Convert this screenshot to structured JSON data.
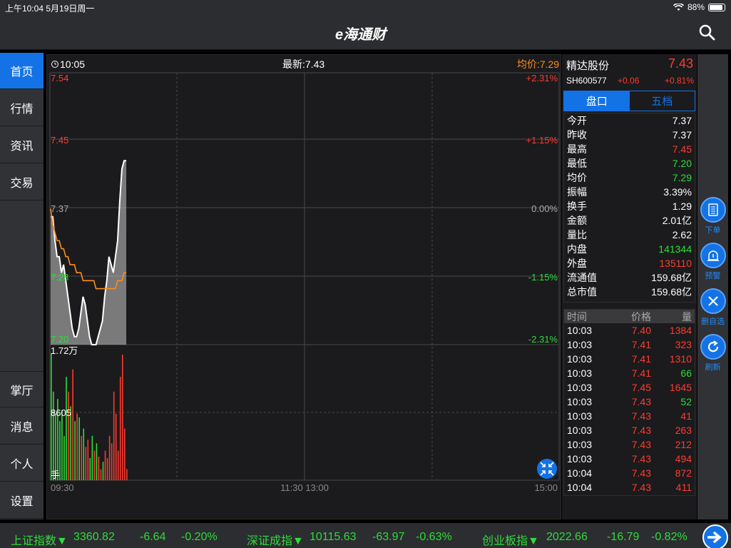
{
  "status_bar": {
    "time": "上午10:04",
    "date": "5月19日周一",
    "battery": "88%"
  },
  "header": {
    "logo": "e海通财"
  },
  "sidebar": {
    "top_items": [
      {
        "label": "首页"
      },
      {
        "label": "行情"
      },
      {
        "label": "资讯"
      },
      {
        "label": "交易"
      }
    ],
    "bottom_items": [
      {
        "label": "掌厅"
      },
      {
        "label": "消息"
      },
      {
        "label": "个人"
      },
      {
        "label": "设置"
      }
    ]
  },
  "chart_header": {
    "time": "10:05",
    "latest": "最新:7.43",
    "avg": "均价:7.29"
  },
  "chart_labels": {
    "price_ticks": [
      "7.54",
      "7.45",
      "7.37",
      "7.28",
      "7.20"
    ],
    "pct_ticks": [
      "+2.31%",
      "+1.15%",
      "0.00%",
      "-1.15%",
      "-2.31%"
    ],
    "vol_max": "1.72万",
    "vol_mid": "8605",
    "vol_unit": "手",
    "x_ticks": [
      "09:30",
      "11:30 13:00",
      "15:00"
    ]
  },
  "chart_data": [
    {
      "type": "line",
      "x": [
        "09:30",
        "09:31",
        "09:32",
        "09:33",
        "09:34",
        "09:35",
        "09:36",
        "09:37",
        "09:38",
        "09:39",
        "09:40",
        "09:41",
        "09:42",
        "09:43",
        "09:44",
        "09:45",
        "09:46",
        "09:47",
        "09:48",
        "09:49",
        "09:50",
        "09:51",
        "09:52",
        "09:53",
        "09:54",
        "09:55",
        "09:56",
        "09:57",
        "09:58",
        "09:59",
        "10:00",
        "10:01",
        "10:02",
        "10:03",
        "10:04",
        "10:05"
      ],
      "series": [
        {
          "values": [
            7.36,
            7.36,
            7.33,
            7.31,
            7.31,
            7.29,
            7.3,
            7.28,
            7.26,
            7.24,
            7.22,
            7.21,
            7.21,
            7.22,
            7.24,
            7.26,
            7.25,
            7.23,
            7.21,
            7.2,
            7.2,
            7.2,
            7.21,
            7.22,
            7.23,
            7.26,
            7.28,
            7.31,
            7.3,
            7.29,
            7.31,
            7.33,
            7.38,
            7.42,
            7.43,
            7.43
          ]
        },
        {
          "values": [
            7.37,
            7.35,
            7.34,
            7.33,
            7.33,
            7.32,
            7.32,
            7.31,
            7.31,
            7.3,
            7.3,
            7.3,
            7.29,
            7.29,
            7.29,
            7.28,
            7.28,
            7.28,
            7.28,
            7.28,
            7.28,
            7.27,
            7.27,
            7.27,
            7.27,
            7.27,
            7.27,
            7.27,
            7.27,
            7.27,
            7.27,
            7.28,
            7.28,
            7.28,
            7.29,
            7.29
          ]
        }
      ],
      "ylim": [
        7.2,
        7.54
      ]
    },
    {
      "type": "bar",
      "values": [
        17200,
        12000,
        9000,
        11000,
        8000,
        9500,
        6000,
        14000,
        12000,
        10000,
        15000,
        8000,
        9000,
        8500,
        6000,
        7000,
        4500,
        5500,
        3000,
        6000,
        4000,
        5000,
        3200,
        1500,
        2500,
        4000,
        3000,
        6000,
        5000,
        12000,
        9000,
        4000,
        14000,
        17000,
        7000,
        1500
      ],
      "colors": [
        "dn",
        "dn",
        "dn",
        "dn",
        "dn",
        "dn",
        "dn",
        "dn",
        "up",
        "dn",
        "up",
        "dn",
        "up",
        "dn",
        "up",
        "dn",
        "up",
        "up",
        "dn",
        "dn",
        "up",
        "dn",
        "up",
        "up",
        "dn",
        "up",
        "up",
        "up",
        "up",
        "up",
        "up",
        "up",
        "up",
        "up",
        "up",
        "up"
      ],
      "ylim": [
        0,
        17200
      ]
    }
  ],
  "stock": {
    "name": "精达股份",
    "price": "7.43",
    "code": "SH600577",
    "change": "+0.06",
    "pct": "+0.81%"
  },
  "tabs": [
    {
      "label": "盘口"
    },
    {
      "label": "五档"
    }
  ],
  "quotes": [
    {
      "label": "今开",
      "value": "7.37",
      "color": "eq"
    },
    {
      "label": "昨收",
      "value": "7.37",
      "color": "eq"
    },
    {
      "label": "最高",
      "value": "7.45",
      "color": "up"
    },
    {
      "label": "最低",
      "value": "7.20",
      "color": "dn"
    },
    {
      "label": "均价",
      "value": "7.29",
      "color": "dn"
    },
    {
      "label": "振幅",
      "value": "3.39%",
      "color": "eq"
    },
    {
      "label": "换手",
      "value": "1.29",
      "color": "eq"
    },
    {
      "label": "金额",
      "value": "2.01亿",
      "color": "eq"
    },
    {
      "label": "量比",
      "value": "2.62",
      "color": "eq"
    },
    {
      "label": "内盘",
      "value": "141344",
      "color": "dn"
    },
    {
      "label": "外盘",
      "value": "135110",
      "color": "up"
    },
    {
      "label": "流通值",
      "value": "159.68亿",
      "color": "eq"
    },
    {
      "label": "总市值",
      "value": "159.68亿",
      "color": "eq"
    }
  ],
  "trades_header": {
    "time": "时间",
    "price": "价格",
    "vol": "量"
  },
  "trades": [
    {
      "time": "10:03",
      "price": "7.40",
      "vol": "1384",
      "vcolor": "up"
    },
    {
      "time": "10:03",
      "price": "7.41",
      "vol": "323",
      "vcolor": "up"
    },
    {
      "time": "10:03",
      "price": "7.41",
      "vol": "1310",
      "vcolor": "up"
    },
    {
      "time": "10:03",
      "price": "7.41",
      "vol": "66",
      "vcolor": "dn"
    },
    {
      "time": "10:03",
      "price": "7.45",
      "vol": "1645",
      "vcolor": "up"
    },
    {
      "time": "10:03",
      "price": "7.43",
      "vol": "52",
      "vcolor": "dn"
    },
    {
      "time": "10:03",
      "price": "7.43",
      "vol": "41",
      "vcolor": "up"
    },
    {
      "time": "10:03",
      "price": "7.43",
      "vol": "263",
      "vcolor": "up"
    },
    {
      "time": "10:03",
      "price": "7.43",
      "vol": "212",
      "vcolor": "up"
    },
    {
      "time": "10:03",
      "price": "7.43",
      "vol": "494",
      "vcolor": "up"
    },
    {
      "time": "10:04",
      "price": "7.43",
      "vol": "872",
      "vcolor": "up"
    },
    {
      "time": "10:04",
      "price": "7.43",
      "vol": "411",
      "vcolor": "up"
    }
  ],
  "actions": [
    {
      "label": "下单",
      "icon": "order-icon"
    },
    {
      "label": "预警",
      "icon": "alarm-icon"
    },
    {
      "label": "删自选",
      "icon": "close-icon"
    },
    {
      "label": "刷新",
      "icon": "refresh-icon"
    }
  ],
  "ticker": [
    {
      "name": "上证指数▼",
      "value": "3360.82",
      "change": "-6.64",
      "pct": "-0.20%"
    },
    {
      "name": "深证成指▼",
      "value": "10115.63",
      "change": "-63.97",
      "pct": "-0.63%"
    },
    {
      "name": "创业板指▼",
      "value": "2022.66",
      "change": "-16.79",
      "pct": "-0.82%"
    }
  ]
}
